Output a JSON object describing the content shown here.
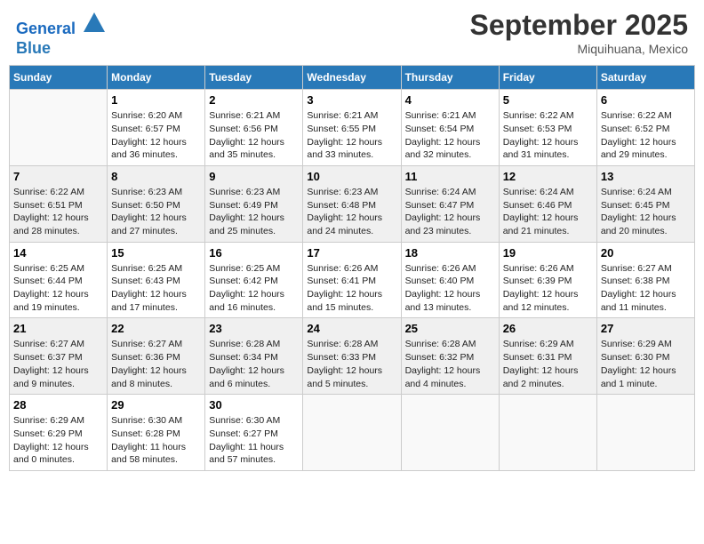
{
  "header": {
    "logo_line1": "General",
    "logo_line2": "Blue",
    "month": "September 2025",
    "location": "Miquihuana, Mexico"
  },
  "days_of_week": [
    "Sunday",
    "Monday",
    "Tuesday",
    "Wednesday",
    "Thursday",
    "Friday",
    "Saturday"
  ],
  "weeks": [
    [
      {
        "day": "",
        "sunrise": "",
        "sunset": "",
        "daylight": ""
      },
      {
        "day": "1",
        "sunrise": "Sunrise: 6:20 AM",
        "sunset": "Sunset: 6:57 PM",
        "daylight": "Daylight: 12 hours and 36 minutes."
      },
      {
        "day": "2",
        "sunrise": "Sunrise: 6:21 AM",
        "sunset": "Sunset: 6:56 PM",
        "daylight": "Daylight: 12 hours and 35 minutes."
      },
      {
        "day": "3",
        "sunrise": "Sunrise: 6:21 AM",
        "sunset": "Sunset: 6:55 PM",
        "daylight": "Daylight: 12 hours and 33 minutes."
      },
      {
        "day": "4",
        "sunrise": "Sunrise: 6:21 AM",
        "sunset": "Sunset: 6:54 PM",
        "daylight": "Daylight: 12 hours and 32 minutes."
      },
      {
        "day": "5",
        "sunrise": "Sunrise: 6:22 AM",
        "sunset": "Sunset: 6:53 PM",
        "daylight": "Daylight: 12 hours and 31 minutes."
      },
      {
        "day": "6",
        "sunrise": "Sunrise: 6:22 AM",
        "sunset": "Sunset: 6:52 PM",
        "daylight": "Daylight: 12 hours and 29 minutes."
      }
    ],
    [
      {
        "day": "7",
        "sunrise": "Sunrise: 6:22 AM",
        "sunset": "Sunset: 6:51 PM",
        "daylight": "Daylight: 12 hours and 28 minutes."
      },
      {
        "day": "8",
        "sunrise": "Sunrise: 6:23 AM",
        "sunset": "Sunset: 6:50 PM",
        "daylight": "Daylight: 12 hours and 27 minutes."
      },
      {
        "day": "9",
        "sunrise": "Sunrise: 6:23 AM",
        "sunset": "Sunset: 6:49 PM",
        "daylight": "Daylight: 12 hours and 25 minutes."
      },
      {
        "day": "10",
        "sunrise": "Sunrise: 6:23 AM",
        "sunset": "Sunset: 6:48 PM",
        "daylight": "Daylight: 12 hours and 24 minutes."
      },
      {
        "day": "11",
        "sunrise": "Sunrise: 6:24 AM",
        "sunset": "Sunset: 6:47 PM",
        "daylight": "Daylight: 12 hours and 23 minutes."
      },
      {
        "day": "12",
        "sunrise": "Sunrise: 6:24 AM",
        "sunset": "Sunset: 6:46 PM",
        "daylight": "Daylight: 12 hours and 21 minutes."
      },
      {
        "day": "13",
        "sunrise": "Sunrise: 6:24 AM",
        "sunset": "Sunset: 6:45 PM",
        "daylight": "Daylight: 12 hours and 20 minutes."
      }
    ],
    [
      {
        "day": "14",
        "sunrise": "Sunrise: 6:25 AM",
        "sunset": "Sunset: 6:44 PM",
        "daylight": "Daylight: 12 hours and 19 minutes."
      },
      {
        "day": "15",
        "sunrise": "Sunrise: 6:25 AM",
        "sunset": "Sunset: 6:43 PM",
        "daylight": "Daylight: 12 hours and 17 minutes."
      },
      {
        "day": "16",
        "sunrise": "Sunrise: 6:25 AM",
        "sunset": "Sunset: 6:42 PM",
        "daylight": "Daylight: 12 hours and 16 minutes."
      },
      {
        "day": "17",
        "sunrise": "Sunrise: 6:26 AM",
        "sunset": "Sunset: 6:41 PM",
        "daylight": "Daylight: 12 hours and 15 minutes."
      },
      {
        "day": "18",
        "sunrise": "Sunrise: 6:26 AM",
        "sunset": "Sunset: 6:40 PM",
        "daylight": "Daylight: 12 hours and 13 minutes."
      },
      {
        "day": "19",
        "sunrise": "Sunrise: 6:26 AM",
        "sunset": "Sunset: 6:39 PM",
        "daylight": "Daylight: 12 hours and 12 minutes."
      },
      {
        "day": "20",
        "sunrise": "Sunrise: 6:27 AM",
        "sunset": "Sunset: 6:38 PM",
        "daylight": "Daylight: 12 hours and 11 minutes."
      }
    ],
    [
      {
        "day": "21",
        "sunrise": "Sunrise: 6:27 AM",
        "sunset": "Sunset: 6:37 PM",
        "daylight": "Daylight: 12 hours and 9 minutes."
      },
      {
        "day": "22",
        "sunrise": "Sunrise: 6:27 AM",
        "sunset": "Sunset: 6:36 PM",
        "daylight": "Daylight: 12 hours and 8 minutes."
      },
      {
        "day": "23",
        "sunrise": "Sunrise: 6:28 AM",
        "sunset": "Sunset: 6:34 PM",
        "daylight": "Daylight: 12 hours and 6 minutes."
      },
      {
        "day": "24",
        "sunrise": "Sunrise: 6:28 AM",
        "sunset": "Sunset: 6:33 PM",
        "daylight": "Daylight: 12 hours and 5 minutes."
      },
      {
        "day": "25",
        "sunrise": "Sunrise: 6:28 AM",
        "sunset": "Sunset: 6:32 PM",
        "daylight": "Daylight: 12 hours and 4 minutes."
      },
      {
        "day": "26",
        "sunrise": "Sunrise: 6:29 AM",
        "sunset": "Sunset: 6:31 PM",
        "daylight": "Daylight: 12 hours and 2 minutes."
      },
      {
        "day": "27",
        "sunrise": "Sunrise: 6:29 AM",
        "sunset": "Sunset: 6:30 PM",
        "daylight": "Daylight: 12 hours and 1 minute."
      }
    ],
    [
      {
        "day": "28",
        "sunrise": "Sunrise: 6:29 AM",
        "sunset": "Sunset: 6:29 PM",
        "daylight": "Daylight: 12 hours and 0 minutes."
      },
      {
        "day": "29",
        "sunrise": "Sunrise: 6:30 AM",
        "sunset": "Sunset: 6:28 PM",
        "daylight": "Daylight: 11 hours and 58 minutes."
      },
      {
        "day": "30",
        "sunrise": "Sunrise: 6:30 AM",
        "sunset": "Sunset: 6:27 PM",
        "daylight": "Daylight: 11 hours and 57 minutes."
      },
      {
        "day": "",
        "sunrise": "",
        "sunset": "",
        "daylight": ""
      },
      {
        "day": "",
        "sunrise": "",
        "sunset": "",
        "daylight": ""
      },
      {
        "day": "",
        "sunrise": "",
        "sunset": "",
        "daylight": ""
      },
      {
        "day": "",
        "sunrise": "",
        "sunset": "",
        "daylight": ""
      }
    ]
  ]
}
